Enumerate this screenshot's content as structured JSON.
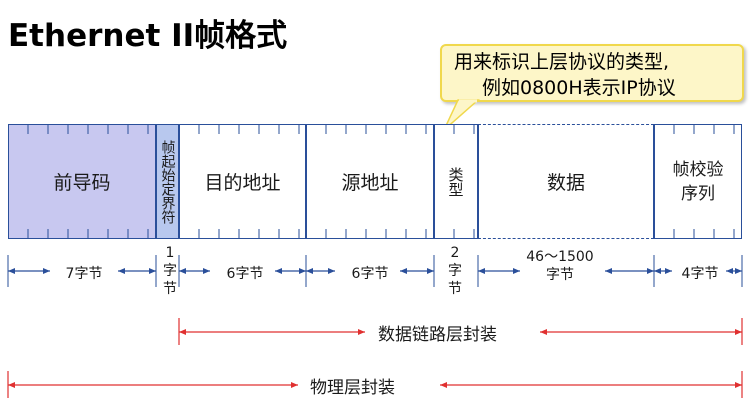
{
  "title": "Ethernet II帧格式",
  "callout": {
    "line1": "用来标识上层协议的类型,",
    "line2": "例如0800H表示IP协议"
  },
  "fields": {
    "preamble": "前导码",
    "sfd": "帧起始定界符",
    "dest": "目的地址",
    "src": "源地址",
    "type": "类型",
    "data": "数据",
    "fcs": "帧校验序列"
  },
  "sizes": {
    "preamble": "7字节",
    "sfd": "1字节",
    "dest": "6字节",
    "src": "6字节",
    "type": "2字节",
    "data": "46～1500字节",
    "fcs": "4字节"
  },
  "layers": {
    "datalink": "数据链路层封装",
    "physical": "物理层封装"
  },
  "colors": {
    "border": "#2a4f9a",
    "preamble_fill": "#c8c8f0",
    "sfd_fill": "#b8c8ee",
    "arrow_red": "#e03030",
    "dim_blue": "#2a4f9a"
  }
}
